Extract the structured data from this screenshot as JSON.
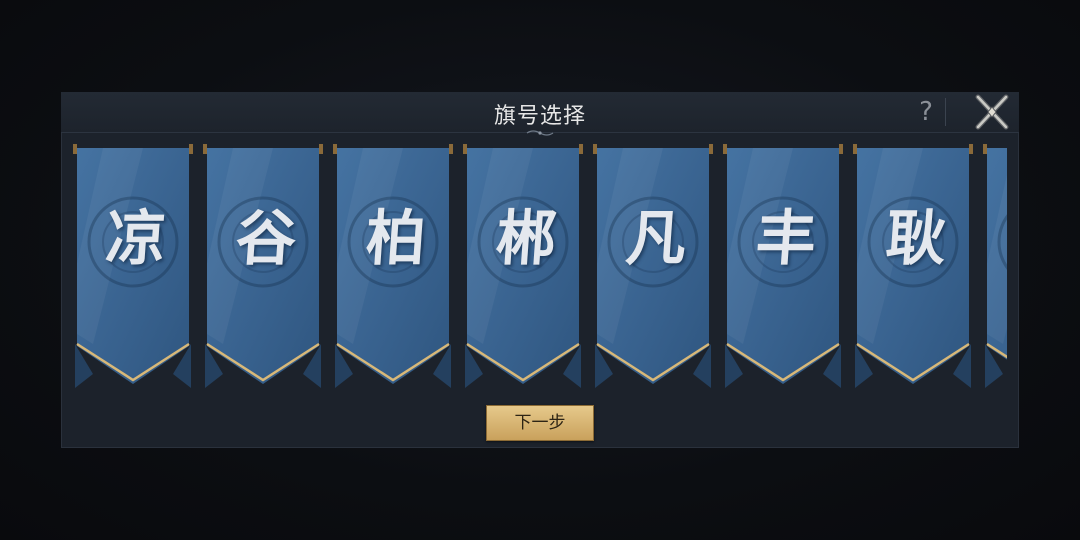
{
  "dialog": {
    "title": "旗号选择",
    "help_label": "?",
    "close_icon": "crossed-swords-close-icon"
  },
  "banners": [
    {
      "char": "凉"
    },
    {
      "char": "谷"
    },
    {
      "char": "柏"
    },
    {
      "char": "郴"
    },
    {
      "char": "凡"
    },
    {
      "char": "丰"
    },
    {
      "char": "耿"
    }
  ],
  "footer": {
    "next_label": "下一步"
  },
  "colors": {
    "banner_blue": "#3a6491",
    "gold_trim": "#d8b878",
    "button_gold": "#d9b675"
  }
}
